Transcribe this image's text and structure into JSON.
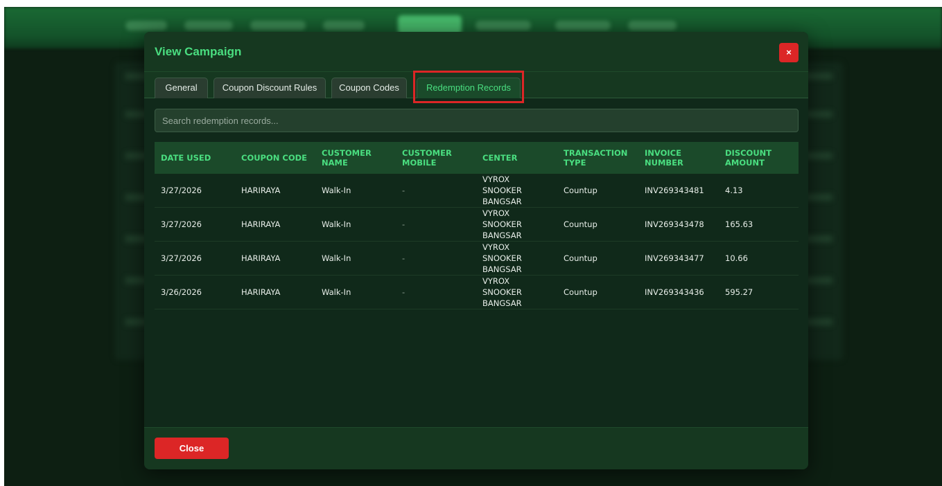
{
  "modal": {
    "title": "View Campaign",
    "close_x": "×",
    "tabs": [
      {
        "label": "General"
      },
      {
        "label": "Coupon Discount Rules"
      },
      {
        "label": "Coupon Codes"
      },
      {
        "label": "Redemption Records"
      }
    ],
    "active_tab": "Redemption Records",
    "search": {
      "placeholder": "Search redemption records...",
      "value": ""
    },
    "table": {
      "headers": [
        "DATE USED",
        "COUPON CODE",
        "CUSTOMER NAME",
        "CUSTOMER MOBILE",
        "CENTER",
        "TRANSACTION TYPE",
        "INVOICE NUMBER",
        "DISCOUNT AMOUNT"
      ],
      "rows": [
        [
          "3/27/2026",
          "HARIRAYA",
          "Walk-In",
          "-",
          "VYROX SNOOKER BANGSAR",
          "Countup",
          "INV269343481",
          "4.13"
        ],
        [
          "3/27/2026",
          "HARIRAYA",
          "Walk-In",
          "-",
          "VYROX SNOOKER BANGSAR",
          "Countup",
          "INV269343478",
          "165.63"
        ],
        [
          "3/27/2026",
          "HARIRAYA",
          "Walk-In",
          "-",
          "VYROX SNOOKER BANGSAR",
          "Countup",
          "INV269343477",
          "10.66"
        ],
        [
          "3/26/2026",
          "HARIRAYA",
          "Walk-In",
          "-",
          "VYROX SNOOKER BANGSAR",
          "Countup",
          "INV269343436",
          "595.27"
        ]
      ]
    },
    "footer": {
      "close_label": "Close"
    }
  },
  "colors": {
    "accent": "#4ade80",
    "danger": "#dc2626",
    "modal_bg": "#10291a",
    "highlight_border": "#dc2626"
  }
}
